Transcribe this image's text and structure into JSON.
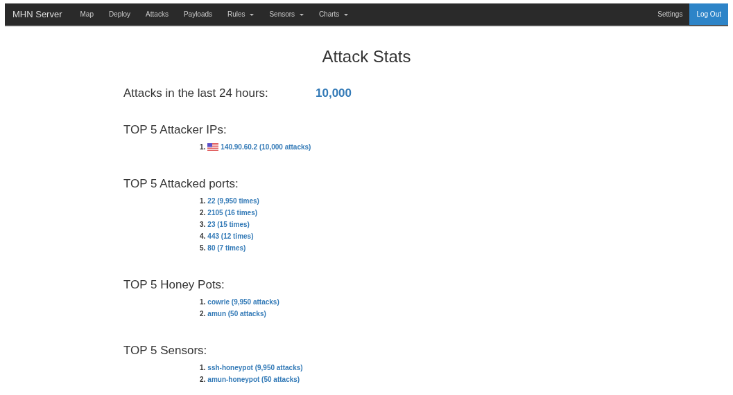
{
  "navbar": {
    "brand": "MHN Server",
    "items": [
      {
        "label": "Map",
        "dropdown": false
      },
      {
        "label": "Deploy",
        "dropdown": false
      },
      {
        "label": "Attacks",
        "dropdown": false
      },
      {
        "label": "Payloads",
        "dropdown": false
      },
      {
        "label": "Rules",
        "dropdown": true
      },
      {
        "label": "Sensors",
        "dropdown": true
      },
      {
        "label": "Charts",
        "dropdown": true
      }
    ],
    "right_items": [
      {
        "label": "Settings",
        "kind": "link"
      },
      {
        "label": "Log Out",
        "kind": "button"
      }
    ]
  },
  "title": "Attack Stats",
  "attacks_24h": {
    "label": "Attacks in the last 24 hours:",
    "value": "10,000"
  },
  "sections": [
    {
      "heading": "TOP 5 Attacker IPs:",
      "items": [
        {
          "number": "1.",
          "text": "140.90.60.2 (10,000 attacks)",
          "flag": true
        }
      ]
    },
    {
      "heading": "TOP 5 Attacked ports:",
      "items": [
        {
          "number": "1.",
          "text": "22 (9,950 times)"
        },
        {
          "number": "2.",
          "text": "2105 (16 times)"
        },
        {
          "number": "3.",
          "text": "23 (15 times)"
        },
        {
          "number": "4.",
          "text": "443 (12 times)"
        },
        {
          "number": "5.",
          "text": "80 (7 times)"
        }
      ]
    },
    {
      "heading": "TOP 5 Honey Pots:",
      "items": [
        {
          "number": "1.",
          "text": "cowrie (9,950 attacks)"
        },
        {
          "number": "2.",
          "text": "amun (50 attacks)"
        }
      ]
    },
    {
      "heading": "TOP 5 Sensors:",
      "items": [
        {
          "number": "1.",
          "text": "ssh-honeypot (9,950 attacks)"
        },
        {
          "number": "2.",
          "text": "amun-honeypot (50 attacks)"
        }
      ]
    }
  ]
}
